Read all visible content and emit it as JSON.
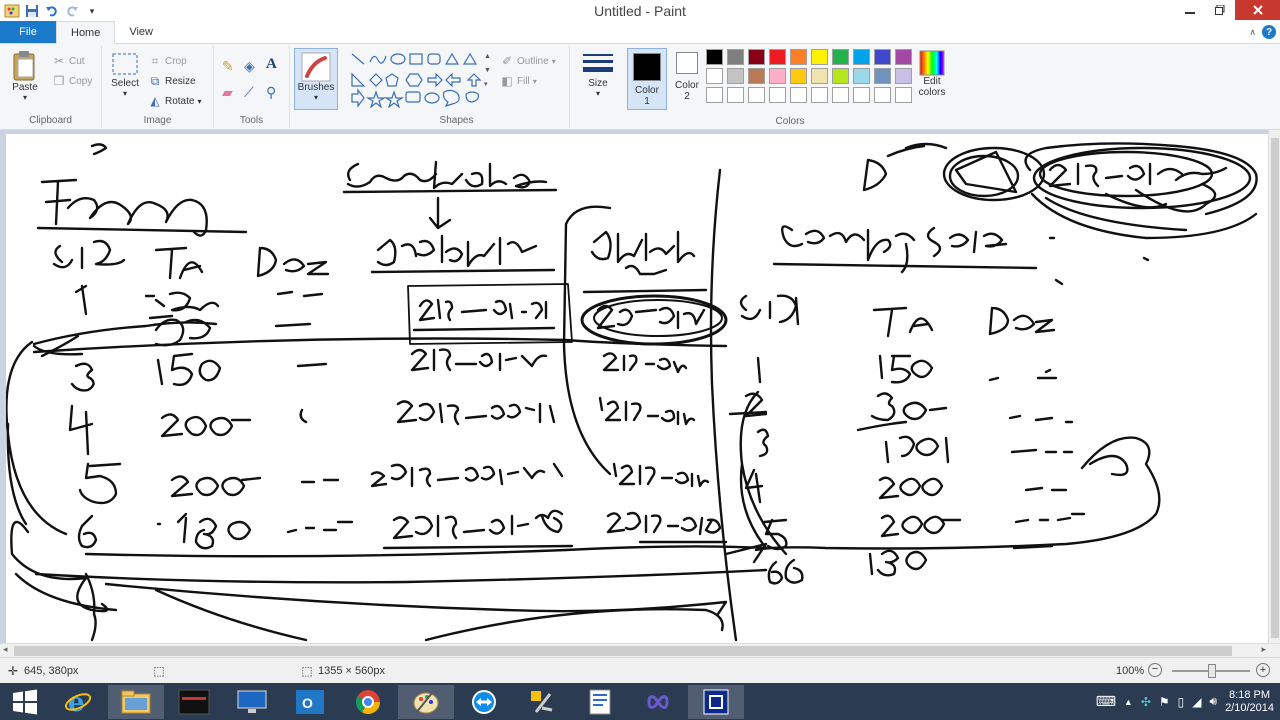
{
  "window": {
    "title": "Untitled - Paint"
  },
  "tabs": {
    "file": "File",
    "home": "Home",
    "view": "View"
  },
  "clipboard": {
    "paste": "Paste",
    "cut": "Cut",
    "copy": "Copy",
    "label": "Clipboard"
  },
  "image": {
    "select": "Select",
    "crop": "Crop",
    "resize": "Resize",
    "rotate": "Rotate",
    "label": "Image"
  },
  "tools": {
    "label": "Tools"
  },
  "brushes": {
    "label": "Brushes"
  },
  "shapes": {
    "outline": "Outline",
    "fill": "Fill",
    "label": "Shapes"
  },
  "size": {
    "label": "Size"
  },
  "colors": {
    "color1_label": "Color",
    "color1_num": "1",
    "color2_label": "Color",
    "color2_num": "2",
    "edit_label": "Edit",
    "edit_label2": "colors",
    "label": "Colors",
    "color1": "#000000",
    "color2": "#ffffff",
    "palette": [
      "#000000",
      "#7f7f7f",
      "#880015",
      "#ed1c24",
      "#ff7f27",
      "#fff200",
      "#22b14c",
      "#00a2e8",
      "#3f48cc",
      "#a349a4",
      "#ffffff",
      "#c3c3c3",
      "#b97a57",
      "#ffaec9",
      "#ffc90e",
      "#efe4b0",
      "#b5e61d",
      "#99d9ea",
      "#7092be",
      "#c8bfe7",
      "#ffffff",
      "#ffffff",
      "#ffffff",
      "#ffffff",
      "#ffffff",
      "#ffffff",
      "#ffffff",
      "#ffffff",
      "#ffffff",
      "#ffffff"
    ]
  },
  "status": {
    "cursor_pos": "645, 380px",
    "canvas_size": "1355 × 560px",
    "zoom": "100%"
  },
  "clock": {
    "time": "8:18 PM",
    "date": "2/10/2014"
  }
}
